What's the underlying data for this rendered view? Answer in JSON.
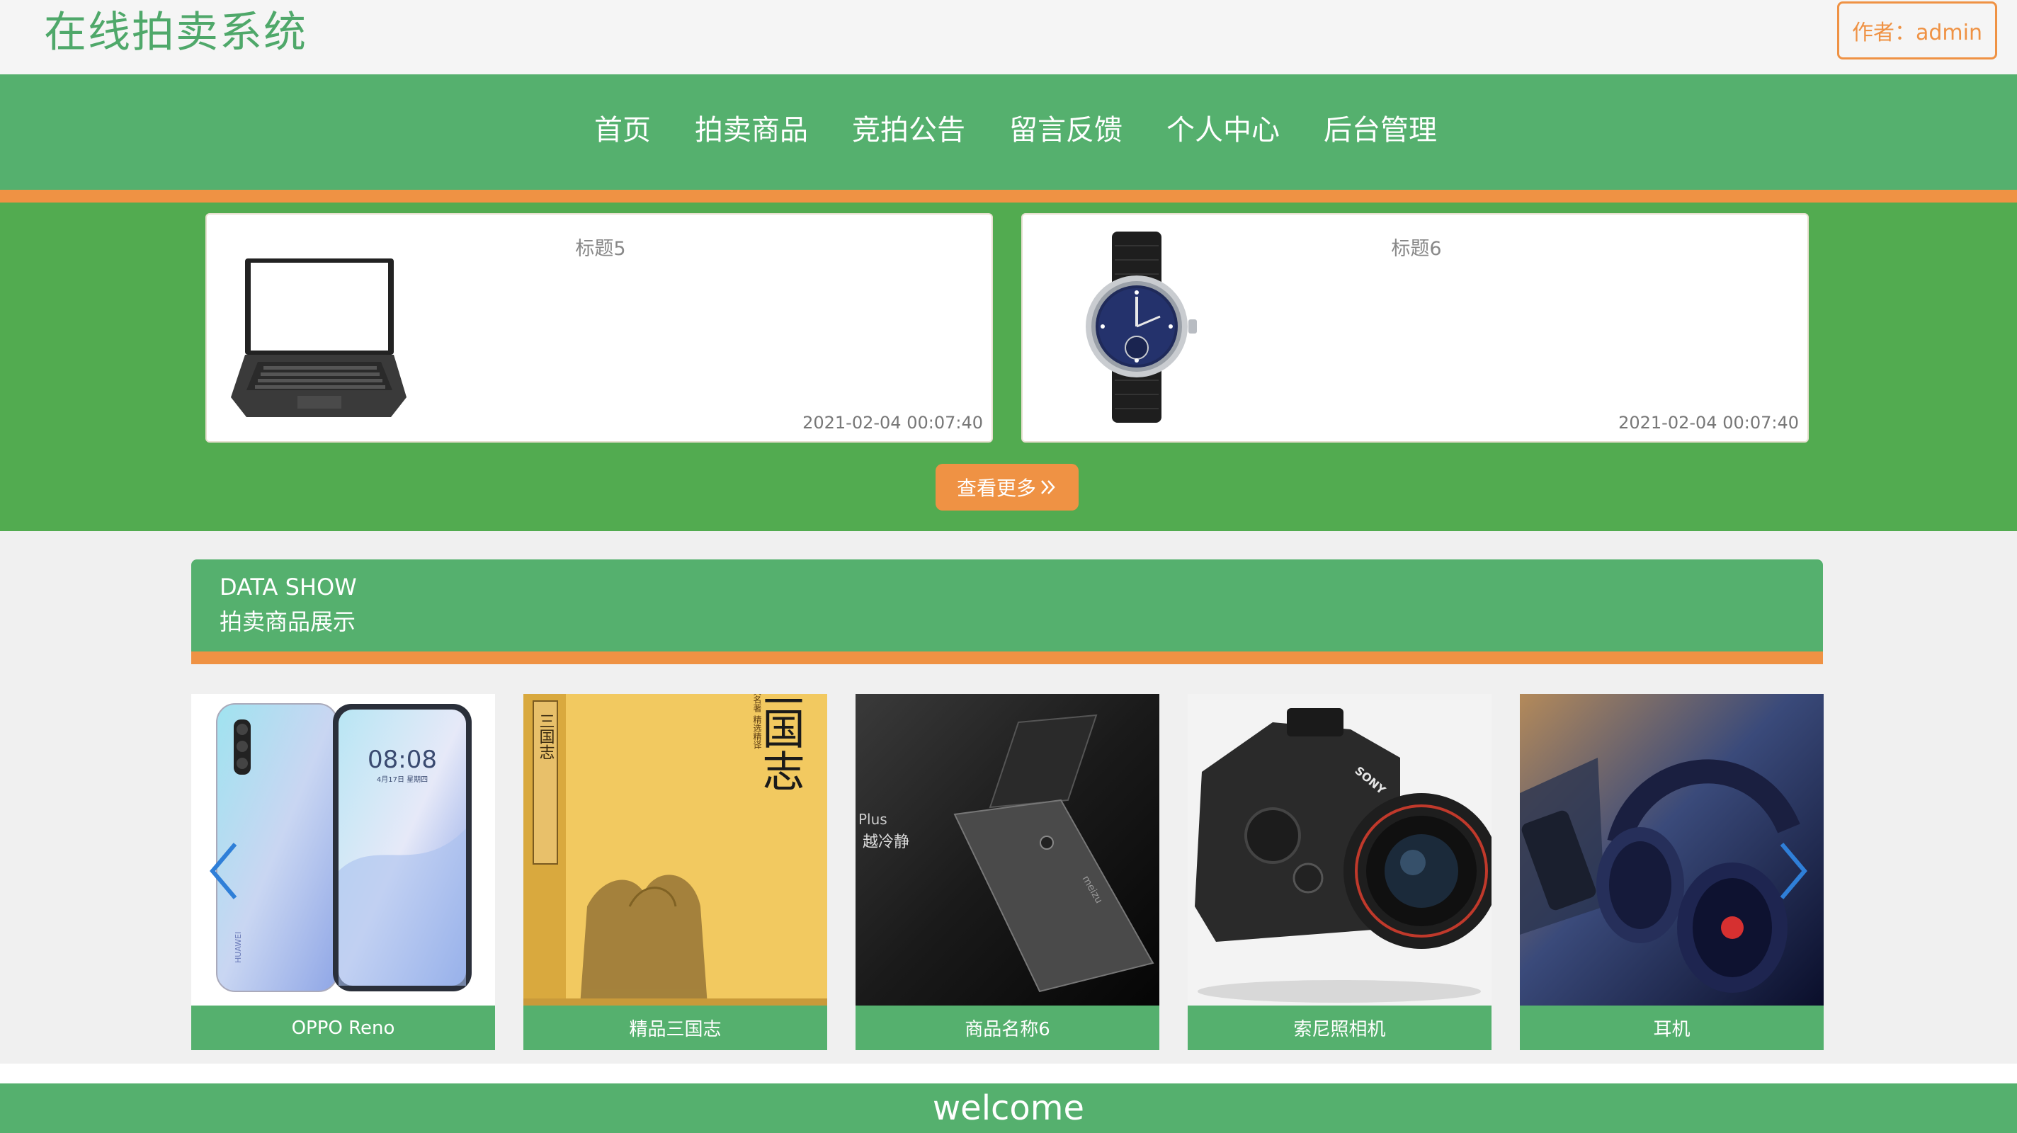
{
  "header": {
    "site_title": "在线拍卖系统",
    "author_label": "作者：admin"
  },
  "nav": {
    "items": [
      {
        "label": "首页"
      },
      {
        "label": "拍卖商品"
      },
      {
        "label": "竞拍公告"
      },
      {
        "label": "留言反馈"
      },
      {
        "label": "个人中心"
      },
      {
        "label": "后台管理"
      }
    ]
  },
  "news": {
    "cards": [
      {
        "title": "标题5",
        "date": "2021-02-04 00:07:40",
        "image": "laptop"
      },
      {
        "title": "标题6",
        "date": "2021-02-04 00:07:40",
        "image": "wristwatch"
      }
    ],
    "more_button": "查看更多",
    "more_icon": "double-chevron-right-icon"
  },
  "data_show": {
    "title_en": "DATA SHOW",
    "title_cn": "拍卖商品展示",
    "products": [
      {
        "name": "OPPO Reno",
        "image": "smartphone",
        "image_text": {
          "time": "08:08",
          "date": "4月17日 星期四",
          "brand": "HUAWEI"
        }
      },
      {
        "name": "精品三国志",
        "image": "book-cover",
        "image_text": {
          "title": "三国志",
          "subtitle": "古典名著 精选精译",
          "spine": "三国志"
        }
      },
      {
        "name": "商品名称6",
        "image": "dark-phone",
        "image_text": {
          "line1": "Plus",
          "line2": "越冷静",
          "brand": "meizu"
        }
      },
      {
        "name": "索尼照相机",
        "image": "camera",
        "image_text": {
          "brand": "SONY"
        }
      },
      {
        "name": "耳机",
        "image": "headphones"
      }
    ]
  },
  "footer": {
    "text": "welcome"
  },
  "colors": {
    "green": "#55b06e",
    "band_green": "#52ab50",
    "orange": "#ef9244",
    "arrow_blue": "#2f7fd8"
  }
}
